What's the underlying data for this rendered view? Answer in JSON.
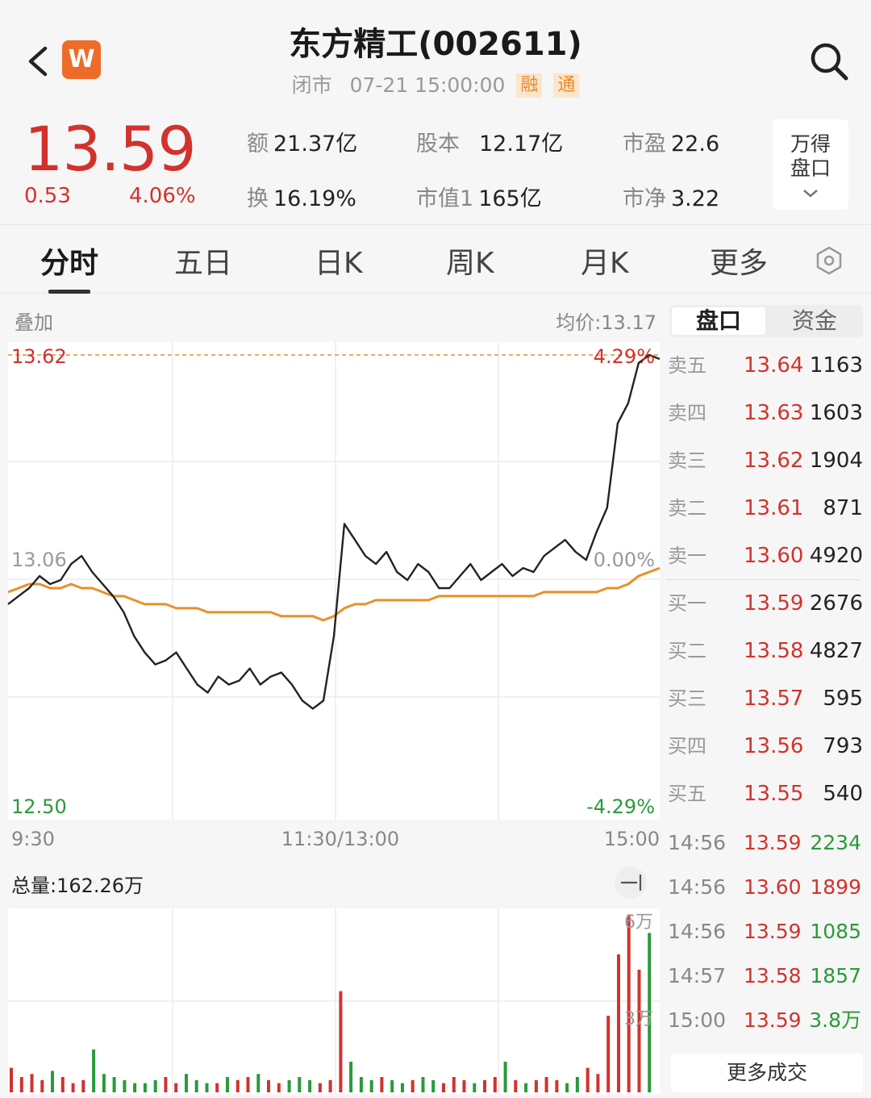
{
  "header": {
    "title": "东方精工(002611)",
    "status": "闭市",
    "datetime": "07-21 15:00:00",
    "tags": [
      "融",
      "通"
    ],
    "logo_letter": "W"
  },
  "quote": {
    "price": "13.59",
    "change": "0.53",
    "change_pct": "4.06%",
    "stats": [
      {
        "label": "额",
        "value": "21.37亿"
      },
      {
        "label": "股本",
        "value": "12.17亿"
      },
      {
        "label": "市盈",
        "value": "22.6"
      },
      {
        "label": "换",
        "value": "16.19%"
      },
      {
        "label": "市值1",
        "value": "165亿"
      },
      {
        "label": "市净",
        "value": "3.22"
      }
    ],
    "panel_button_line1": "万得",
    "panel_button_line2": "盘口"
  },
  "tabs": [
    "分时",
    "五日",
    "日K",
    "周K",
    "月K",
    "更多"
  ],
  "chart": {
    "overlay_label": "叠加",
    "avg_label": "均价:13.17",
    "y_top": "13.62",
    "y_mid": "13.06",
    "y_bottom": "12.50",
    "pct_top": "4.29%",
    "pct_mid": "0.00%",
    "pct_bottom": "-4.29%",
    "x_start": "9:30",
    "x_mid": "11:30/13:00",
    "x_end": "15:00",
    "volume_label": "总量:162.26万",
    "vol_top": "6万",
    "vol_mid": "3万"
  },
  "chart_data": {
    "type": "line",
    "title": "",
    "xlabel": "",
    "ylabel": "",
    "ylim": [
      12.5,
      13.62
    ],
    "x_ticks": [
      "9:30",
      "11:30/13:00",
      "15:00"
    ],
    "series": [
      {
        "values": [
          13.0,
          13.02,
          13.04,
          13.07,
          13.05,
          13.06,
          13.1,
          13.12,
          13.08,
          13.05,
          13.02,
          12.98,
          12.92,
          12.88,
          12.85,
          12.86,
          12.88,
          12.84,
          12.8,
          12.78,
          12.82,
          12.8,
          12.81,
          12.84,
          12.8,
          12.82,
          12.83,
          12.8,
          12.76,
          12.74,
          12.76,
          12.92,
          13.2,
          13.16,
          13.12,
          13.1,
          13.13,
          13.08,
          13.06,
          13.1,
          13.08,
          13.04,
          13.04,
          13.07,
          13.1,
          13.06,
          13.08,
          13.1,
          13.07,
          13.09,
          13.08,
          13.12,
          13.14,
          13.16,
          13.13,
          13.11,
          13.18,
          13.24,
          13.45,
          13.5,
          13.6,
          13.62,
          13.61
        ]
      },
      {
        "values": [
          13.03,
          13.04,
          13.05,
          13.05,
          13.04,
          13.04,
          13.05,
          13.04,
          13.04,
          13.03,
          13.02,
          13.02,
          13.01,
          13.0,
          13.0,
          13.0,
          12.99,
          12.99,
          12.99,
          12.98,
          12.98,
          12.98,
          12.98,
          12.98,
          12.98,
          12.98,
          12.97,
          12.97,
          12.97,
          12.97,
          12.96,
          12.97,
          12.99,
          13.0,
          13.0,
          13.01,
          13.01,
          13.01,
          13.01,
          13.01,
          13.01,
          13.02,
          13.02,
          13.02,
          13.02,
          13.02,
          13.02,
          13.02,
          13.02,
          13.02,
          13.02,
          13.03,
          13.03,
          13.03,
          13.03,
          13.03,
          13.03,
          13.04,
          13.04,
          13.05,
          13.07,
          13.08,
          13.09
        ]
      }
    ],
    "volume": [
      8,
      5,
      6,
      4,
      7,
      5,
      3,
      4,
      14,
      6,
      5,
      4,
      3,
      3,
      4,
      5,
      3,
      6,
      4,
      3,
      3,
      5,
      4,
      5,
      6,
      4,
      3,
      4,
      5,
      4,
      3,
      4,
      33,
      10,
      5,
      4,
      5,
      4,
      3,
      4,
      5,
      4,
      3,
      5,
      4,
      3,
      4,
      5,
      10,
      4,
      3,
      4,
      5,
      4,
      3,
      5,
      8,
      6,
      25,
      45,
      58,
      40,
      52
    ],
    "volume_ylim": [
      0,
      60000
    ]
  },
  "orderbook": {
    "tabs": [
      "盘口",
      "资金"
    ],
    "asks": [
      {
        "label": "卖五",
        "price": "13.64",
        "vol": "1163"
      },
      {
        "label": "卖四",
        "price": "13.63",
        "vol": "1603"
      },
      {
        "label": "卖三",
        "price": "13.62",
        "vol": "1904"
      },
      {
        "label": "卖二",
        "price": "13.61",
        "vol": "871"
      },
      {
        "label": "卖一",
        "price": "13.60",
        "vol": "4920"
      }
    ],
    "bids": [
      {
        "label": "买一",
        "price": "13.59",
        "vol": "2676"
      },
      {
        "label": "买二",
        "price": "13.58",
        "vol": "4827"
      },
      {
        "label": "买三",
        "price": "13.57",
        "vol": "595"
      },
      {
        "label": "买四",
        "price": "13.56",
        "vol": "793"
      },
      {
        "label": "买五",
        "price": "13.55",
        "vol": "540"
      }
    ],
    "trades": [
      {
        "time": "14:56",
        "price": "13.59",
        "vol": "2234",
        "color": "#2a9a3a"
      },
      {
        "time": "14:56",
        "price": "13.60",
        "vol": "1899",
        "color": "#d2322d"
      },
      {
        "time": "14:56",
        "price": "13.59",
        "vol": "1085",
        "color": "#2a9a3a"
      },
      {
        "time": "14:57",
        "price": "13.58",
        "vol": "1857",
        "color": "#2a9a3a"
      },
      {
        "time": "15:00",
        "price": "13.59",
        "vol": "3.8万",
        "color": "#2a9a3a"
      }
    ],
    "more_trades": "更多成交"
  },
  "colors": {
    "up": "#d2322d",
    "down": "#2a9a3a",
    "avg": "#e8902c",
    "price_line": "#222222"
  }
}
